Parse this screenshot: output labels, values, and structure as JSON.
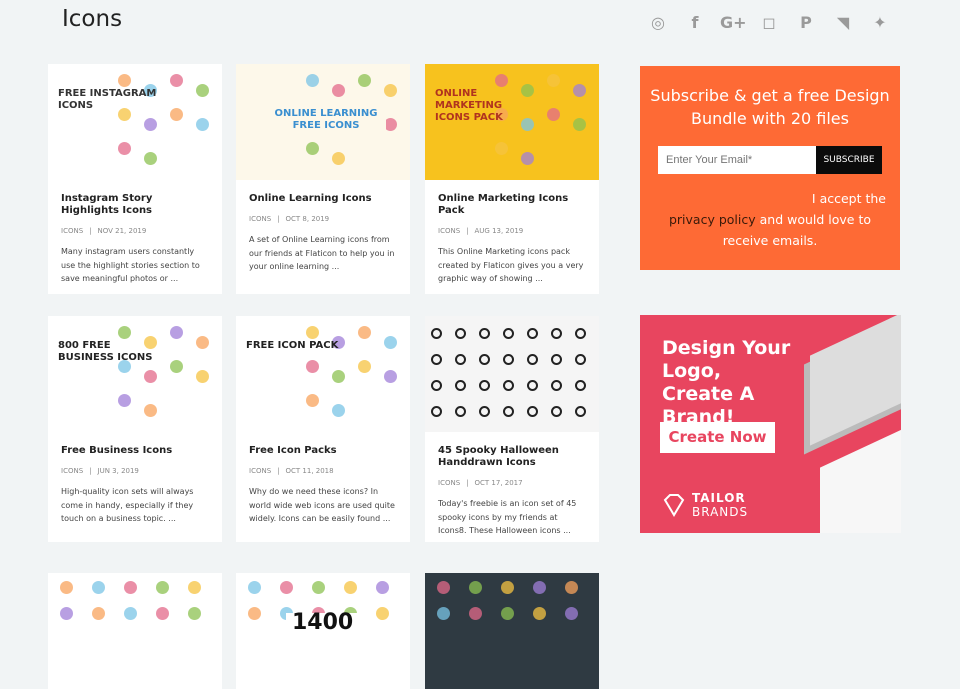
{
  "header": {
    "title": "Icons"
  },
  "social": [
    {
      "name": "dribbble-icon",
      "glyph": "◎"
    },
    {
      "name": "facebook-icon",
      "glyph": "f"
    },
    {
      "name": "google-plus-icon",
      "glyph": "G+"
    },
    {
      "name": "instagram-icon",
      "glyph": "◻"
    },
    {
      "name": "pinterest-icon",
      "glyph": "P"
    },
    {
      "name": "rss-icon",
      "glyph": "◥"
    },
    {
      "name": "twitter-icon",
      "glyph": "✦"
    }
  ],
  "posts": [
    {
      "title": "Instagram Story Highlights Icons",
      "category": "ICONS",
      "date": "NOV 21, 2019",
      "excerpt": "Many instagram users constantly use the highlight stories section to save meaningful photos or ...",
      "thumb_text": "FREE INSTAGRAM ICONS",
      "thumb_bg": "#ffffff",
      "thumb_fg": "#333333"
    },
    {
      "title": "Online Learning Icons",
      "category": "ICONS",
      "date": "OCT 8, 2019",
      "excerpt": "A set of Online Learning icons from our friends at Flaticon to help you in your online learning ...",
      "thumb_text": "ONLINE LEARNING FREE ICONS",
      "thumb_bg": "#fdf8ea",
      "thumb_fg": "#3a8fd0"
    },
    {
      "title": "Online Marketing Icons Pack",
      "category": "ICONS",
      "date": "AUG 13, 2019",
      "excerpt": "This Online Marketing icons pack created by Flaticon gives you a very graphic way of showing ...",
      "thumb_text": "ONLINE MARKETING ICONS PACK",
      "thumb_bg": "#f7c21e",
      "thumb_fg": "#b0331f"
    },
    {
      "title": "Free Business Icons",
      "category": "ICONS",
      "date": "JUN 3, 2019",
      "excerpt": "High-quality icon sets will always come in handy, especially if they touch on a business topic. ...",
      "thumb_text": "800 FREE BUSINESS ICONS",
      "thumb_bg": "#ffffff",
      "thumb_fg": "#222222"
    },
    {
      "title": "Free Icon Packs",
      "category": "ICONS",
      "date": "OCT 11, 2018",
      "excerpt": "Why do we need these icons? In world wide web icons are used quite widely. Icons can be easily found ...",
      "thumb_text": "FREE ICON PACK",
      "thumb_bg": "#ffffff",
      "thumb_fg": "#222222"
    },
    {
      "title": "45 Spooky Halloween Handdrawn Icons",
      "category": "ICONS",
      "date": "OCT 17, 2017",
      "excerpt": "Today's freebie is an icon set of 45 spooky icons by my friends at Icons8. These Halloween icons ...",
      "thumb_text": "",
      "thumb_bg": "#f5f5f5",
      "thumb_fg": "#111111"
    },
    {
      "title": "",
      "category": "",
      "date": "",
      "excerpt": "",
      "thumb_text": "",
      "thumb_bg": "#ffffff",
      "thumb_fg": "#333333"
    },
    {
      "title": "",
      "category": "",
      "date": "",
      "excerpt": "",
      "thumb_text": "1400",
      "thumb_bg": "#ffffff",
      "thumb_fg": "#111111"
    },
    {
      "title": "",
      "category": "",
      "date": "",
      "excerpt": "",
      "thumb_text": "",
      "thumb_bg": "#2f3a42",
      "thumb_fg": "#ffffff"
    }
  ],
  "subscribe": {
    "heading": "Subscribe & get a free Design Bundle with 20 files",
    "email_placeholder": "Enter Your Email*",
    "button": "SUBSCRIBE",
    "accept_prefix": "I accept the",
    "privacy_link": "privacy policy",
    "accept_suffix": " and would love to receive emails.",
    "bg": "#fe6a35"
  },
  "ad": {
    "headline": "Design Your Logo, Create A Brand!",
    "cta": "Create Now",
    "brand_line1": "TAILOR",
    "brand_line2": "BRANDS",
    "bg": "#e8455f"
  }
}
